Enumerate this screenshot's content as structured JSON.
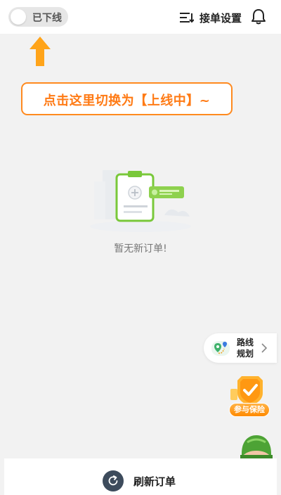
{
  "header": {
    "status_label": "已下线",
    "settings_label": "接单设置",
    "icons": {
      "settings": "list-settings-icon",
      "notifications": "bell-icon"
    }
  },
  "guide": {
    "text": "点击这里切换为【上线中】~",
    "arrow_icon": "arrow-up-icon",
    "accent": "#ff8a1f"
  },
  "empty_state": {
    "message": "暂无新订单!",
    "illustration": "empty-orders-clipboard"
  },
  "floating": {
    "route_label_line1": "路线",
    "route_label_line2": "规划",
    "insurance_label": "参与保险"
  },
  "footer": {
    "refresh_label": "刷新订单",
    "refresh_icon": "refresh-icon"
  },
  "colors": {
    "accent_orange": "#ff8a1f",
    "brand_green": "#7ccf3c",
    "background": "#f2f2f2"
  }
}
